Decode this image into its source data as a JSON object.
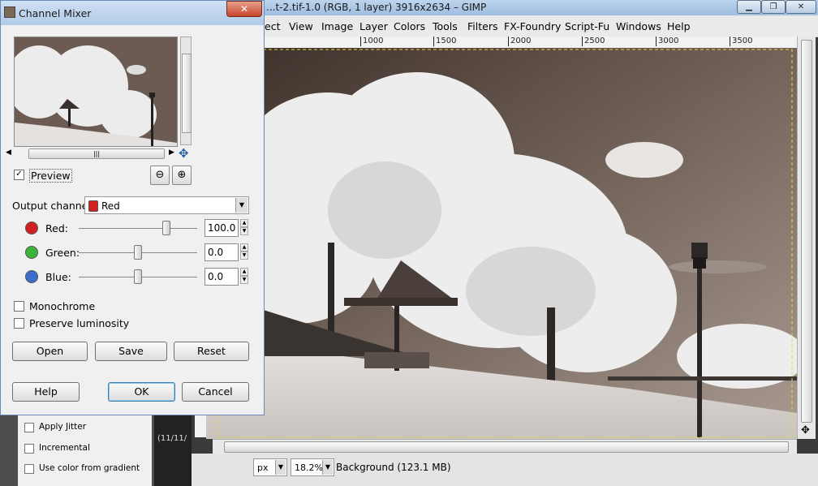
{
  "gimp": {
    "title": "...t-2.tif-1.0 (RGB, 1 layer) 3916x2634 – GIMP",
    "menu": [
      "ect",
      "View",
      "Image",
      "Layer",
      "Colors",
      "Tools",
      "Filters",
      "FX-Foundry",
      "Script-Fu",
      "Windows",
      "Help"
    ],
    "ruler_marks": [
      "1000",
      "1500",
      "2000",
      "2500",
      "3000",
      "3500"
    ],
    "status": {
      "unit": "px",
      "zoom": "18.2%",
      "layer_info": "Background (123.1 MB)"
    }
  },
  "toolbox": {
    "options": [
      "Apply Jitter",
      "Incremental",
      "Use color from gradient"
    ],
    "date_fragment": "(11/11/"
  },
  "dialog": {
    "title": "Channel Mixer",
    "close_glyph": "✕",
    "preview_label": "Preview",
    "preview_checked": true,
    "output_channel_label": "Output channel:",
    "output_channel_value": "Red",
    "channels": [
      {
        "label": "Red:",
        "value": "100.0",
        "slider_fraction": 0.75,
        "color": "#d02020"
      },
      {
        "label": "Green:",
        "value": "0.0",
        "slider_fraction": 0.5,
        "color": "#3cb43c"
      },
      {
        "label": "Blue:",
        "value": "0.0",
        "slider_fraction": 0.5,
        "color": "#3a6ec8"
      }
    ],
    "monochrome_label": "Monochrome",
    "preserve_label": "Preserve luminosity",
    "buttons": {
      "open": "Open",
      "save": "Save",
      "reset": "Reset",
      "help": "Help",
      "ok": "OK",
      "cancel": "Cancel"
    }
  }
}
